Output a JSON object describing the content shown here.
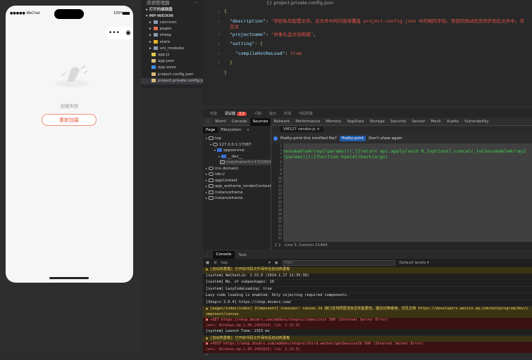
{
  "simulator": {
    "carrier": "●●●●● WeChat",
    "battery": "100%",
    "capsule_more": "•••",
    "capsule_close": "◉",
    "fail_text": "加载失败",
    "reload_label": "重新加载"
  },
  "explorer": {
    "title": "资源管理器",
    "more": "···",
    "open_editors": "打开的编辑器",
    "project": "MP-WEIXIN",
    "items": [
      {
        "label": "common",
        "icon": "folder-icon",
        "color": "#8a9bb0"
      },
      {
        "label": "pages",
        "icon": "folder-icon",
        "color": "#e06c4a"
      },
      {
        "label": "sheep",
        "icon": "folder-icon",
        "color": "#8a9bb0"
      },
      {
        "label": "static",
        "icon": "folder-icon",
        "color": "#e6b422"
      },
      {
        "label": "uni_modules",
        "icon": "folder-icon",
        "color": "#8a9bb0"
      },
      {
        "label": "app.js",
        "icon": "js-file-icon",
        "color": "#e6c84a"
      },
      {
        "label": "app.json",
        "icon": "json-file-icon",
        "color": "#d7ba7d"
      },
      {
        "label": "app.wxss",
        "icon": "wxss-file-icon",
        "color": "#3b8eea"
      },
      {
        "label": "project.config.json",
        "icon": "json-file-icon",
        "color": "#d7ba7d"
      },
      {
        "label": "project.private.config.js...",
        "icon": "json-file-icon",
        "color": "#d7ba7d"
      }
    ]
  },
  "editor": {
    "breadcrumb": "{} project.private.config.json",
    "lines": [
      {
        "n": "1",
        "text": "{"
      },
      {
        "n": "2",
        "key": "\"description\"",
        "value": "\"项目私有配置文件。此文件中的内容将覆盖 project.config.json 中的相同字段。项目的改动优先同步到此文件中。详见文"
      },
      {
        "n": "3",
        "key": "\"projectname\"",
        "value": "\"井象礼品文创商城\""
      },
      {
        "n": "4",
        "key": "\"setting\"",
        "text": ": {"
      },
      {
        "n": "5",
        "key": "\"compileHotReLoad\"",
        "value": "true"
      },
      {
        "n": "6",
        "text": "}"
      },
      {
        "n": "7",
        "text": "}"
      }
    ]
  },
  "devtools": {
    "top_tabs": [
      "构建",
      "调试器",
      "问题",
      "输出",
      "终端",
      "代码质量"
    ],
    "badge": "3,3",
    "panel_tabs": [
      "Wxml",
      "Console",
      "Sources",
      "Network",
      "Performance",
      "Memory",
      "AppData",
      "Storage",
      "Security",
      "Sensor",
      "Mock",
      "Audits",
      "Vulnerability"
    ],
    "active_panel": "Sources",
    "nav_tabs": [
      "Page",
      "Filesystem",
      "»"
    ],
    "tree": [
      {
        "label": "top",
        "icon": "frame-icon"
      },
      {
        "label": "127.0.0.1:17087",
        "icon": "cloud-icon"
      },
      {
        "label": "appservice",
        "icon": "folder-icon"
      },
      {
        "label": "__dev__",
        "icon": "folder-icon"
      },
      {
        "label": "mainframe?t=1721802296345",
        "icon": "file-icon"
      },
      {
        "label": "(no domain)",
        "icon": "cloud-icon"
      },
      {
        "label": "ide://",
        "icon": "cloud-icon"
      },
      {
        "label": "appContext",
        "icon": "frame-icon"
      },
      {
        "label": "app_wxframe_renderContext",
        "icon": "frame-icon"
      },
      {
        "label": "instanceframe",
        "icon": "frame-icon"
      },
      {
        "label": "instanceframe",
        "icon": "frame-icon"
      }
    ],
    "file_tab": "VM127 vendor.js ×",
    "pretty_prompt": "Pretty-print this minified file?",
    "pretty_btn": "Pretty-print",
    "dont_show": "Don't show again",
    "line_numbers": [
      "2",
      "3",
      "4",
      "5",
      "6",
      "7",
      "8",
      "9",
      "10",
      "11",
      "12",
      "13",
      "14",
      "15",
      "16",
      "17",
      "18",
      "19",
      "20",
      "21",
      "22",
      "23",
      "24",
      "25"
    ],
    "code_line": "onsumableArray2(params)));]}return api.apply(void 0,[options].concat(_toConsumableArray2(params)));}function hasCallback(args)",
    "position": "Line 3, Column 21444"
  },
  "console": {
    "tabs": [
      "Console",
      "Task"
    ],
    "context": "top",
    "filter_placeholder": "Filter",
    "levels": "Default levels ▾",
    "messages": [
      {
        "type": "warn",
        "text": "▲ [自动热重载] 已开启代码文件保存后自动热重载"
      },
      {
        "type": "log",
        "text": "[system] WeChatLib: 2.33.0 (2024.1.17 21:35:30)"
      },
      {
        "type": "log",
        "text": "[system] No. of subpackages: 10"
      },
      {
        "type": "log",
        "text": "[system] LazyCodeLoading: true"
      },
      {
        "type": "log",
        "text": "Lazy code loading is enabled. Only injecting required components."
      },
      {
        "type": "log",
        "text": "[Shopro 3.0.4]  https://shop.docmrx.com/"
      },
      {
        "type": "warn",
        "text": "▲ [pages/index/index] [Component] <canvas>: canvas 2d 接口支持同层渲染且性能更佳，建议切换使用。详见文档 https://developers.weixin.qq.com/miniprogram/dev/component/canvas"
      },
      {
        "type": "err",
        "text": "■ ▸GET https://shop.docmrx.com/addons/shopro/index/init 500 (Internal Server Error)",
        "sub": "(env: Windows,mp,1.06.2401020; lib: 2.33.0)"
      },
      {
        "type": "log",
        "text": "[system] Launch Time: 2315 ms"
      },
      {
        "type": "warn",
        "text": "▲ [自动热重载] 已开启代码文件保存后自动热重载"
      },
      {
        "type": "err",
        "text": "■ ▸POST https://shop.docmrx.com/addons/shopro/third.wechat/getSessionId 500 (Internal Server Error)",
        "sub": "(env: Windows,mp,1.06.2401020; lib: 2.33.0)"
      },
      {
        "type": "log",
        "text": "›"
      }
    ]
  },
  "colors": {
    "accent": "#e8553a",
    "error_bg": "#3a1212",
    "warn_bg": "#3b3414",
    "code_green": "#3fd24a"
  }
}
